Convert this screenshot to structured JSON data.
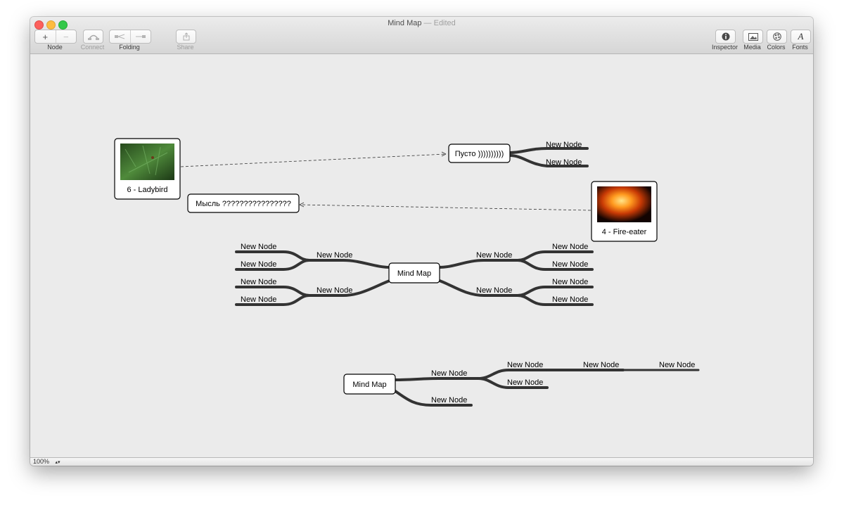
{
  "window": {
    "title": "Mind Map",
    "edited": "— Edited"
  },
  "toolbar": {
    "node": {
      "label": "Node",
      "add": "+",
      "remove": "−"
    },
    "connect": {
      "label": "Connect"
    },
    "folding": {
      "label": "Folding"
    },
    "share": {
      "label": "Share"
    },
    "inspector": {
      "label": "Inspector"
    },
    "media": {
      "label": "Media"
    },
    "colors": {
      "label": "Colors"
    },
    "fonts": {
      "label": "Fonts",
      "glyph": "A"
    }
  },
  "canvas": {
    "image_nodes": [
      {
        "caption": "6 - Ladybird",
        "image": "green-foliage-photo"
      },
      {
        "caption": "4 - Fire-eater",
        "image": "fire-breathing-photo"
      }
    ],
    "text_nodes": [
      {
        "text": "Пусто ))))))))))"
      },
      {
        "text": "Мысль ????????????????"
      }
    ],
    "map1": {
      "root": "Mind Map",
      "left_branches": [
        "New Node",
        "New Node"
      ],
      "left_leaves": [
        "New Node",
        "New Node",
        "New Node",
        "New Node"
      ],
      "right_branches": [
        "New Node",
        "New Node"
      ],
      "right_leaves": [
        "New Node",
        "New Node",
        "New Node",
        "New Node"
      ]
    },
    "pusto_children": [
      "New Node",
      "New Node"
    ],
    "map2": {
      "root": "Mind Map",
      "branches": [
        "New Node",
        "New Node"
      ],
      "sub": [
        "New Node",
        "New Node"
      ],
      "chain": [
        "New Node",
        "New Node"
      ]
    }
  },
  "status": {
    "zoom": "100%"
  }
}
